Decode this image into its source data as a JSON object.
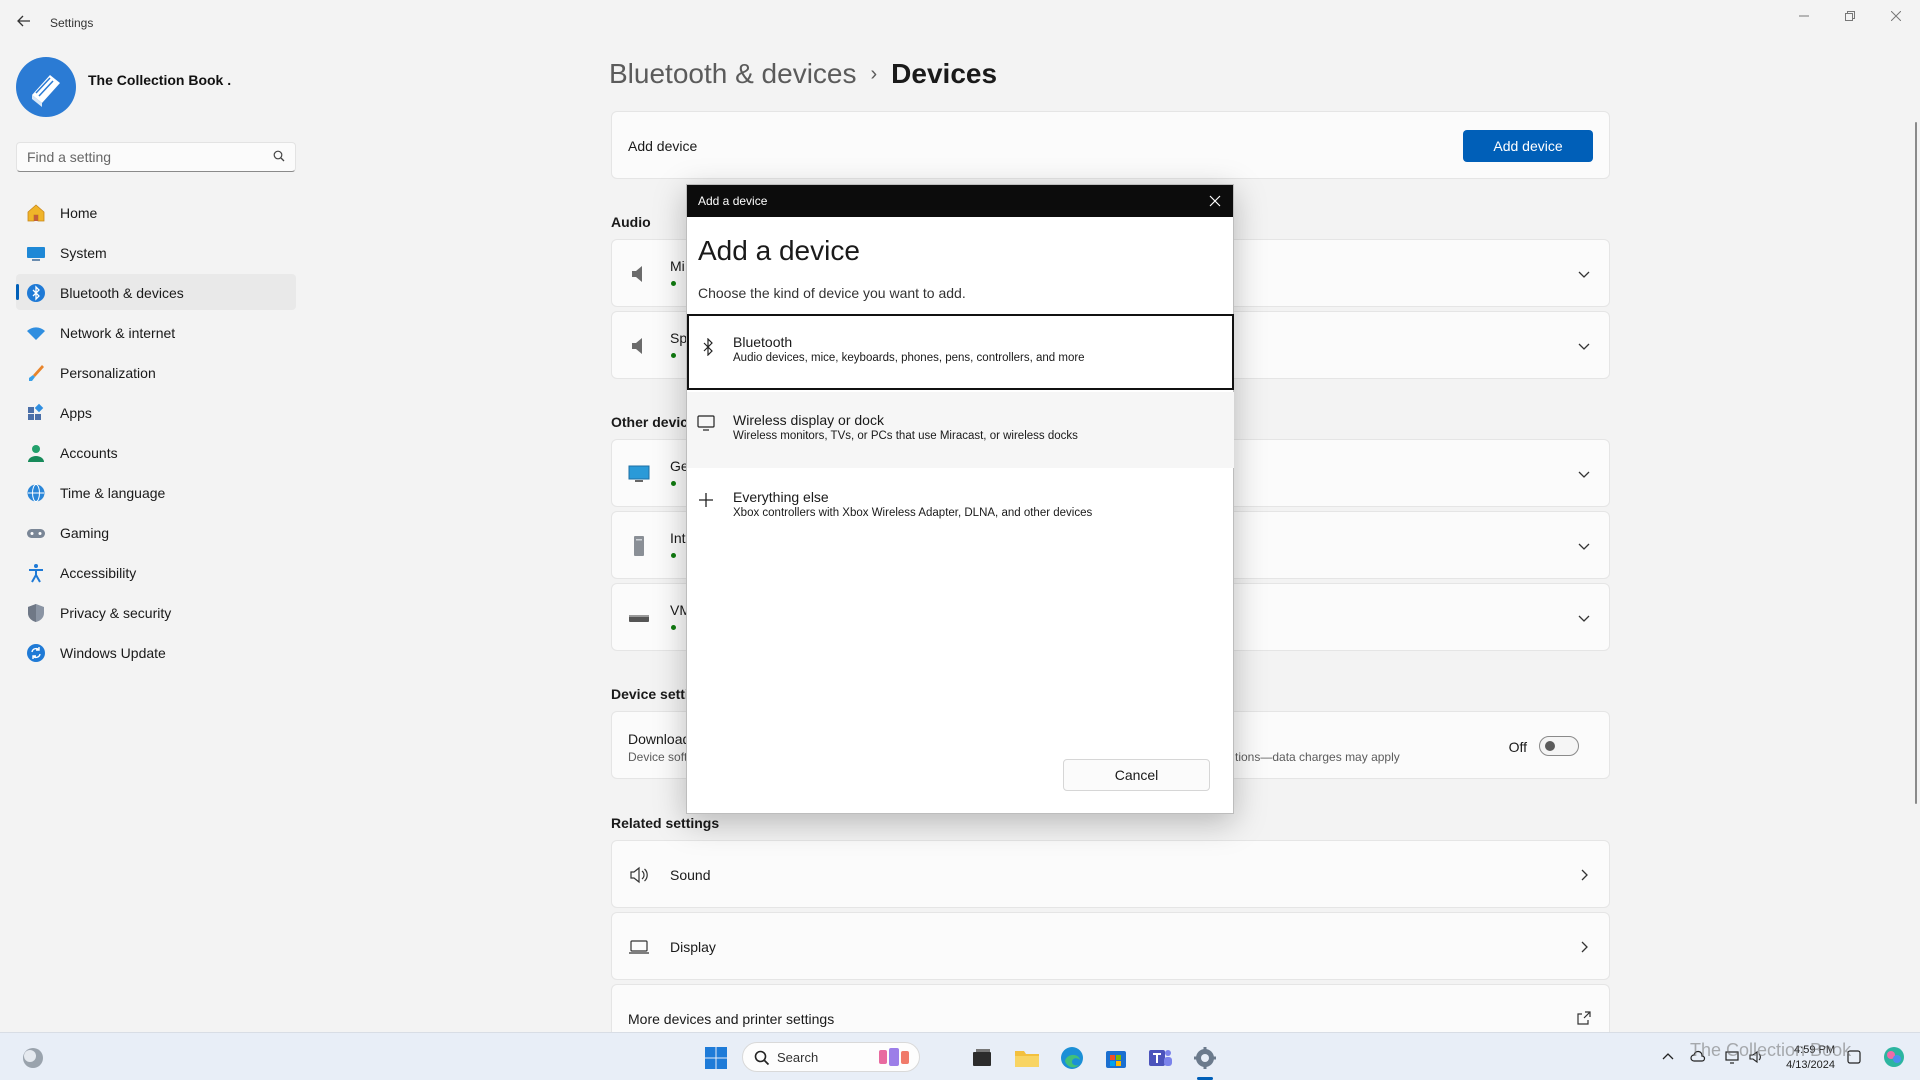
{
  "window": {
    "title": "Settings"
  },
  "profile": {
    "name": "The Collection Book ."
  },
  "search": {
    "placeholder": "Find a setting"
  },
  "nav": [
    {
      "label": "Home",
      "icon": "home-icon"
    },
    {
      "label": "System",
      "icon": "system-icon"
    },
    {
      "label": "Bluetooth & devices",
      "icon": "bluetooth-icon",
      "active": true
    },
    {
      "label": "Network & internet",
      "icon": "wifi-icon"
    },
    {
      "label": "Personalization",
      "icon": "brush-icon"
    },
    {
      "label": "Apps",
      "icon": "apps-icon"
    },
    {
      "label": "Accounts",
      "icon": "account-icon"
    },
    {
      "label": "Time & language",
      "icon": "globe-icon"
    },
    {
      "label": "Gaming",
      "icon": "gamepad-icon"
    },
    {
      "label": "Accessibility",
      "icon": "accessibility-icon"
    },
    {
      "label": "Privacy & security",
      "icon": "shield-icon"
    },
    {
      "label": "Windows Update",
      "icon": "update-icon"
    }
  ],
  "breadcrumb": {
    "parent": "Bluetooth & devices",
    "separator": "›",
    "current": "Devices"
  },
  "add_device_card": {
    "label": "Add device",
    "button": "Add device"
  },
  "sections": {
    "audio": "Audio",
    "other_devices": "Other devic",
    "device_settings": "Device settin",
    "related": "Related settings"
  },
  "audio_devices": [
    {
      "name": "Mi"
    },
    {
      "name": "Sp"
    }
  ],
  "other_devices": [
    {
      "name": "Ge"
    },
    {
      "name": "Int"
    },
    {
      "name": "VM"
    }
  ],
  "download_setting": {
    "title": "Download",
    "subtitle_left": "Device soft",
    "subtitle_right": "tions—data charges may apply",
    "state": "Off"
  },
  "related_settings": [
    {
      "label": "Sound",
      "icon": "speaker-icon"
    },
    {
      "label": "Display",
      "icon": "laptop-icon"
    },
    {
      "label": "More devices and printer settings",
      "icon": "external-link-icon"
    }
  ],
  "dialog": {
    "header": "Add a device",
    "title": "Add a device",
    "subtitle": "Choose the kind of device you want to add.",
    "options": [
      {
        "title": "Bluetooth",
        "desc": "Audio devices, mice, keyboards, phones, pens, controllers, and more",
        "icon": "bluetooth-icon"
      },
      {
        "title": "Wireless display or dock",
        "desc": "Wireless monitors, TVs, or PCs that use Miracast, or wireless docks",
        "icon": "monitor-icon"
      },
      {
        "title": "Everything else",
        "desc": "Xbox controllers with Xbox Wireless Adapter, DLNA, and other devices",
        "icon": "plus-icon"
      }
    ],
    "cancel": "Cancel"
  },
  "taskbar": {
    "search_label": "Search",
    "time": "4:59 PM",
    "date": "4/13/2024"
  },
  "watermark": "The Collection Book",
  "colors": {
    "accent": "#005fb8",
    "online_dot": "#0f7b0f",
    "dialog_header": "#0c0c0c"
  }
}
